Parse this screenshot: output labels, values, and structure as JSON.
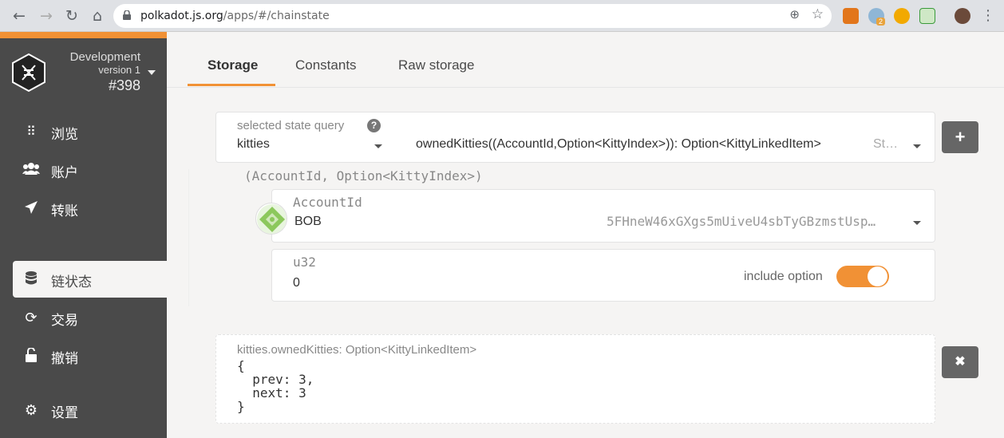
{
  "browser": {
    "url_host": "polkadot.js.org",
    "url_path": "/apps/#/chainstate",
    "extension_badge": "2"
  },
  "sidebar": {
    "chain_name": "Development",
    "chain_version": "version 1",
    "block_number": "#398",
    "items": [
      {
        "label": "浏览",
        "icon": "grid-icon"
      },
      {
        "label": "账户",
        "icon": "users-icon"
      },
      {
        "label": "转账",
        "icon": "send-icon"
      },
      {
        "label": "链状态",
        "icon": "database-icon",
        "active": true
      },
      {
        "label": "交易",
        "icon": "sync-icon"
      },
      {
        "label": "撤销",
        "icon": "unlock-icon"
      },
      {
        "label": "设置",
        "icon": "gears-icon"
      }
    ],
    "accent_color": "#f19135"
  },
  "tabs": [
    {
      "label": "Storage",
      "active": true
    },
    {
      "label": "Constants"
    },
    {
      "label": "Raw storage"
    }
  ],
  "query": {
    "label": "selected state query",
    "module": "kitties",
    "method": "ownedKitties((AccountId,Option<KittyIndex>)): Option<KittyLinkedItem>",
    "method_suffix": "St…",
    "add_button": "+"
  },
  "params": {
    "title": "(AccountId, Option<KittyIndex>)",
    "account": {
      "label": "AccountId",
      "name": "BOB",
      "address": "5FHneW46xGXgs5mUiveU4sbTyGBzmstUsp…"
    },
    "u32": {
      "label": "u32",
      "value": "0",
      "include_option_label": "include option",
      "include_option_on": true
    }
  },
  "result": {
    "title": "kitties.ownedKitties: Option<KittyLinkedItem>",
    "body": "{\n  prev: 3,\n  next: 3\n}",
    "remove_button": "✖"
  }
}
